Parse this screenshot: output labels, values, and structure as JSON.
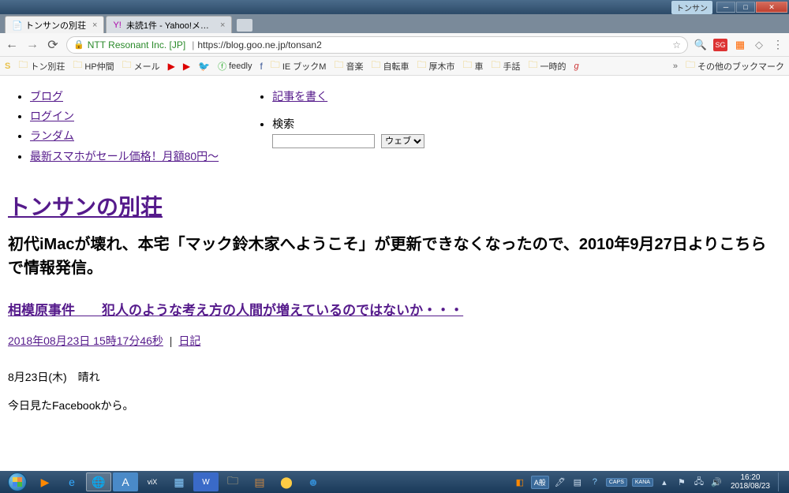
{
  "titlebar": {
    "user": "トンサン"
  },
  "tabs": [
    {
      "label": "トンサンの別荘",
      "active": true
    },
    {
      "label": "未読1件 - Yahoo!メール",
      "active": false
    }
  ],
  "omnibox": {
    "org": "NTT Resonant Inc. [JP]",
    "url": "https://blog.goo.ne.jp/tonsan2"
  },
  "bookmarks": {
    "items": [
      "トン別荘",
      "HP仲間",
      "メール",
      "",
      "",
      "",
      "feedly",
      "",
      "IE ブックM",
      "音楽",
      "自転車",
      "厚木市",
      "車",
      "手話",
      "一時的",
      ""
    ],
    "other": "その他のブックマーク"
  },
  "nav_left": {
    "items": [
      "ブログ",
      "ログイン",
      "ランダム",
      "最新スマホがセール価格！月額80円～"
    ]
  },
  "nav_right": {
    "write": "記事を書く",
    "search_label": "検索",
    "select": "ウェブ"
  },
  "site": {
    "title": "トンサンの別荘",
    "desc": "初代iMacが壊れ、本宅「マック鈴木家へようこそ」が更新できなくなったので、2010年9月27日よりこちらで情報発信。"
  },
  "post": {
    "title": "相模原事件　　犯人のような考え方の人間が増えているのではないか・・・",
    "date": "2018年08月23日 15時17分46秒",
    "category": "日記",
    "line1": "8月23日(木)　晴れ",
    "line2": "今日見たFacebookから。"
  },
  "tray": {
    "ime_mode": "A般",
    "caps": "CAPS",
    "kana": "KANA",
    "time": "16:20",
    "date": "2018/08/23"
  }
}
